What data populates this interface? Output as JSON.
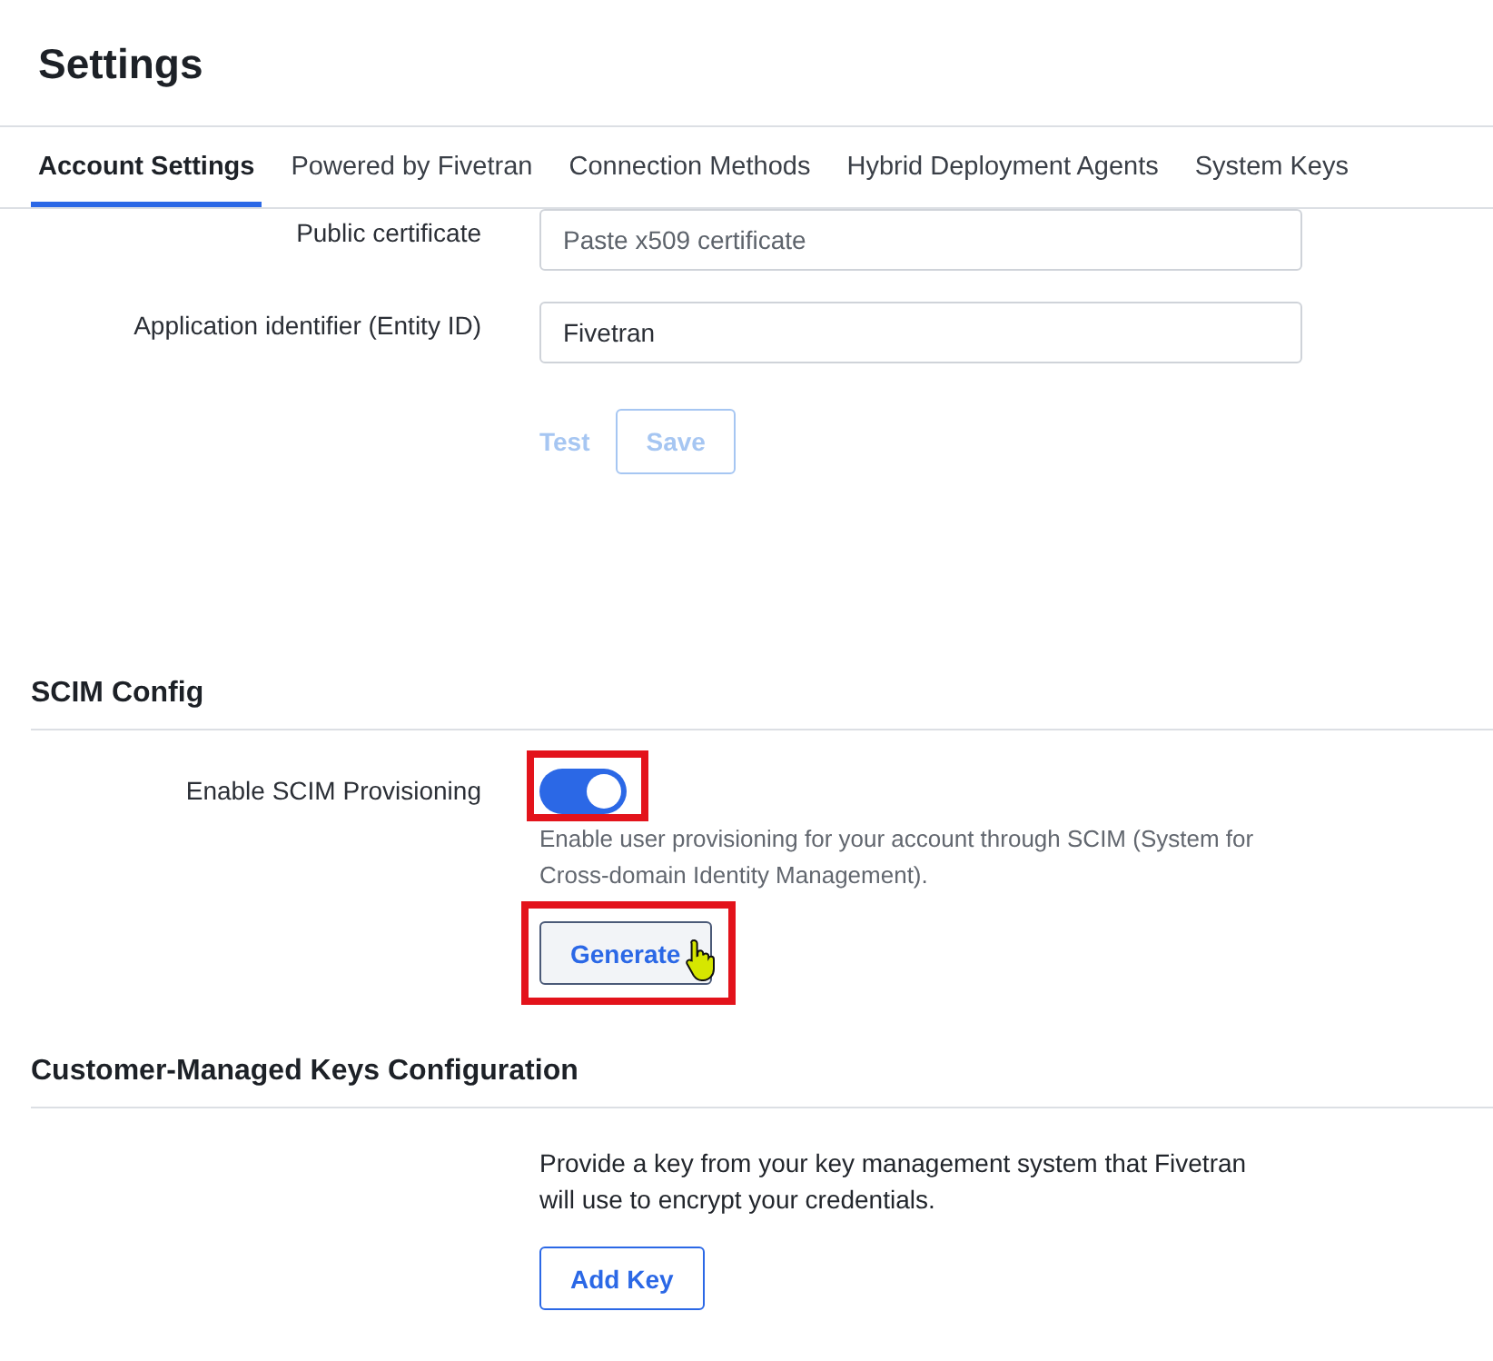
{
  "page": {
    "title": "Settings"
  },
  "tabs": [
    {
      "label": "Account Settings",
      "selected": true
    },
    {
      "label": "Powered by Fivetran",
      "selected": false
    },
    {
      "label": "Connection Methods",
      "selected": false
    },
    {
      "label": "Hybrid Deployment Agents",
      "selected": false
    },
    {
      "label": "System Keys",
      "selected": false
    }
  ],
  "saml_fields": [
    {
      "label": "Public certificate",
      "placeholder": "Paste x509 certificate"
    },
    {
      "label": "Application identifier (Entity ID)",
      "value": "Fivetran"
    }
  ],
  "saml_actions": [
    {
      "label": "Test",
      "kind": "link",
      "disabled": true
    },
    {
      "label": "Save",
      "kind": "outline",
      "disabled": true
    }
  ],
  "scim": {
    "heading": "SCIM Config",
    "toggle": {
      "label": "Enable SCIM Provisioning",
      "on": true,
      "highlighted": true
    },
    "description": "Enable user provisioning for your account through SCIM (System for Cross-domain Identity Management).",
    "button": {
      "label": "Generate",
      "highlighted": true,
      "hovered": true
    }
  },
  "keys": {
    "heading": "Customer-Managed Keys Configuration",
    "description": "Provide a key from your key management system that Fivetran will use to encrypt your credentials.",
    "button": {
      "label": "Add Key",
      "highlighted": false,
      "hovered": false
    }
  }
}
